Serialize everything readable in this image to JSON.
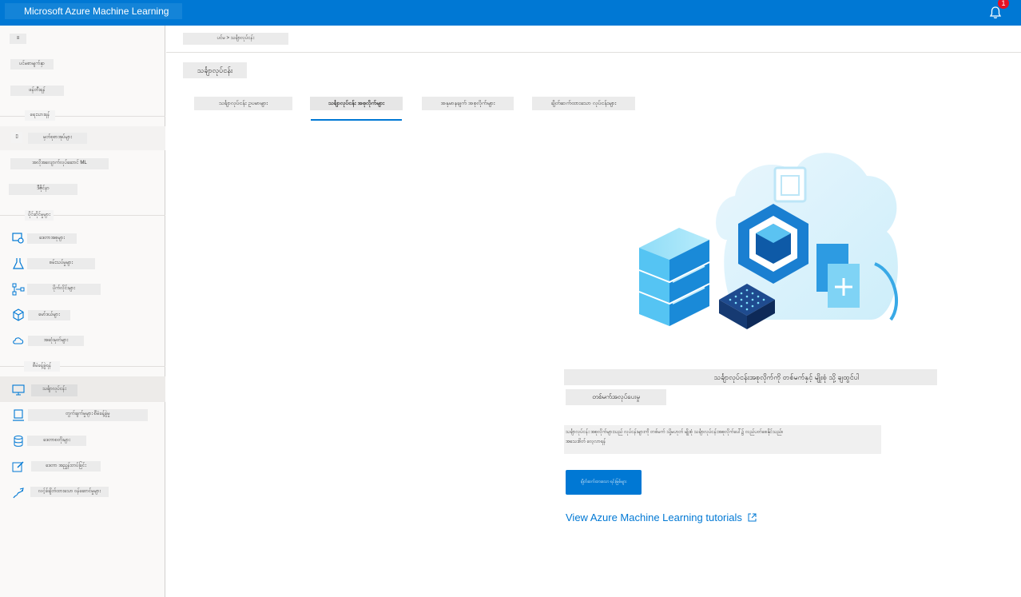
{
  "colors": {
    "brand": "#0078d4",
    "badge": "#e81123"
  },
  "header": {
    "app_title": "Microsoft Azure Machine Learning",
    "notification_count": "1"
  },
  "sidebar": {
    "collapse": "≡",
    "top_items": [
      {
        "label": "ပင်မစာမျက်နှာ",
        "icon": "home-icon"
      },
      {
        "label": "ဖန်တီးရန်",
        "icon": "plus-icon"
      }
    ],
    "sections": [
      {
        "heading": "ရေးသားရန်",
        "items": [
          {
            "label": "မှတ်စုစာအုပ်များ",
            "icon": "notebook-icon"
          },
          {
            "label": "အလိုအလျောက်လုပ်ဆောင် ML",
            "icon": "lightning-icon"
          },
          {
            "label": "ဒီဇိုင်နာ",
            "icon": "designer-icon"
          }
        ]
      },
      {
        "heading": "ပိုင်ဆိုင်မှုများ",
        "items": [
          {
            "label": "ဒေတာအစုများ",
            "icon": "dataset-icon"
          },
          {
            "label": "စမ်းသပ်မှုများ",
            "icon": "flask-icon"
          },
          {
            "label": "ပိုက်လိုင်းများ",
            "icon": "pipeline-icon"
          },
          {
            "label": "မော်ဒယ်များ",
            "icon": "cube-icon"
          },
          {
            "label": "အဆုံးမှတ်များ",
            "icon": "cloud-endpoint-icon"
          }
        ]
      },
      {
        "heading": "စီမံခန့်ခွဲရန်",
        "items": [
          {
            "label": "သင်္ချာလုပ်ငန်း",
            "icon": "compute-icon"
          },
          {
            "label": "တွက်ချက်မှုများ စီမံခန့်ခွဲမှု",
            "icon": "laptop-icon"
          },
          {
            "label": "ဒေတာစတိုးများ",
            "icon": "database-icon"
          },
          {
            "label": "ဒေတာ အညွှန်းတပ်ခြင်း",
            "icon": "edit-icon"
          },
          {
            "label": "လင့်ခ်ချိတ်ထားသော ဝန်ဆောင်မှုများ",
            "icon": "link-icon"
          }
        ]
      }
    ]
  },
  "breadcrumb": "ပင်မ > သင်္ချာလုပ်ငန်း",
  "page_title": "သင်္ချာလုပ်ငန်း",
  "tabs": [
    {
      "label": "သင်္ချာလုပ်ငန်း ဥပမာများ",
      "active": false
    },
    {
      "label": "သင်္ချာလုပ်ငန်း အစုလိုက်များ",
      "active": true
    },
    {
      "label": "အနုမာနချက် အစုလိုက်များ",
      "active": false
    },
    {
      "label": "ချိတ်ဆက်ထားသော လုပ်ငန်းများ",
      "active": false
    }
  ],
  "empty_state": {
    "title": "သင်္ချာလုပ်ငန်းအစုလိုက်ကို တစ်မက်နှင့် မျိုးစုံ သို့ ချထွင်ပါ",
    "subtitle": "တစ်မက်အလုပ်ပေးမှု",
    "description_line1": "သင်္ချာလုပ်ငန်း အစုလိုက်များသည် လုပ်ငန်းများကို တစ်မက် သို့မဟုတ် မျိုးစုံ သင်္ချာလုပ်ငန်းအစုလိုက်ပေါ်၌ လည်ပတ်စေနိုင်သည်။",
    "description_line2": "အသေးစိတ် လေ့လာရန်",
    "create_button": "ချိတ်ဆက်ထားသော ရင်းမြစ်များ",
    "tutorial_link": "View Azure Machine Learning tutorials"
  }
}
